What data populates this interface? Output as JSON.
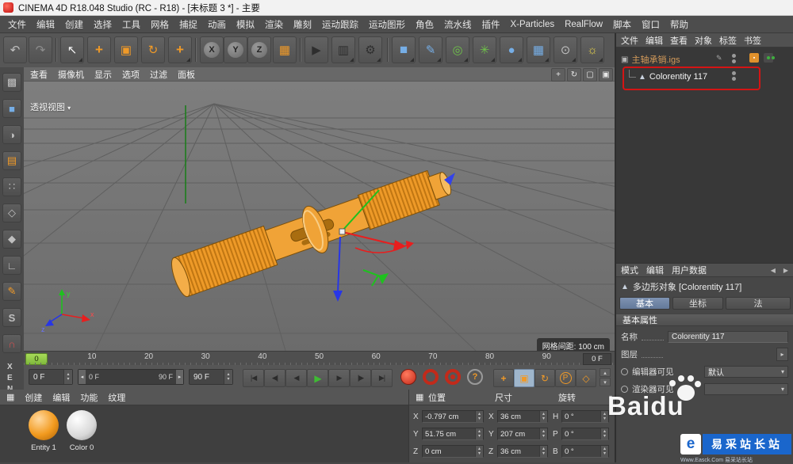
{
  "titlebar": {
    "title": "CINEMA 4D R18.048 Studio (RC - R18) - [未标题 3 *] - 主要"
  },
  "menubar": {
    "items": [
      "文件",
      "编辑",
      "创建",
      "选择",
      "工具",
      "网格",
      "捕捉",
      "动画",
      "模拟",
      "渲染",
      "雕刻",
      "运动跟踪",
      "运动图形",
      "角色",
      "流水线",
      "插件",
      "X-Particles",
      "RealFlow",
      "脚本",
      "窗口",
      "帮助"
    ]
  },
  "icons": {
    "undo": "↶",
    "redo": "↷",
    "select": "↖",
    "move": "+",
    "scale": "▣",
    "rotate": "↻",
    "last_tool": "+",
    "x": "X",
    "y": "Y",
    "z": "Z",
    "coords": "▦",
    "render_view": "▶",
    "render_region": "▥",
    "render_settings": "⚙",
    "cube": "■",
    "pen": "✎",
    "subdiv": "◎",
    "mograph": "✳",
    "metaball": "●",
    "array": "▦",
    "camera": "⊙",
    "light": "☼",
    "layout": "▩",
    "model": "■",
    "texture": "◑",
    "workplane": "▤",
    "points": "∷",
    "edges": "◇",
    "polygons": "◆",
    "axis": "∟",
    "pen2": "✎",
    "snap": "S",
    "magnet": "∩",
    "vp_pan": "+",
    "vp_rotate": "↻",
    "vp_scale": "▢",
    "vp_max": "▣",
    "grid_menu": "▦",
    "dropdown": "▾",
    "flyout": "▸",
    "spin_up": "▴",
    "spin_down": "▾",
    "jump_start": "|◀",
    "prev_key": "◀|",
    "prev_frame": "◀",
    "play": "▶",
    "next_frame": "▶",
    "next_key": "|▶",
    "jump_end": "▶|",
    "help": "?",
    "key_move": "+",
    "key_scale": "▣",
    "key_rotate": "↻",
    "key_param": "P",
    "key_pla": "◇",
    "pencil": "✎",
    "cube_small": "▣",
    "poly_obj": "▲",
    "back": "◀",
    "fwd": "▶"
  },
  "left_strip": {
    "letters": [
      "X",
      "E",
      "N"
    ]
  },
  "viewport": {
    "menu": [
      "查看",
      "摄像机",
      "显示",
      "选项",
      "过滤",
      "面板"
    ],
    "view_label": "透视视图",
    "grid_label": "网格间距: 100 cm"
  },
  "timeline": {
    "playhead": "0",
    "ticks": [
      "10",
      "20",
      "30",
      "40",
      "50",
      "60",
      "70",
      "80",
      "90"
    ],
    "ruler_field": "0 F"
  },
  "transport": {
    "current": "0 F",
    "range_start": "0 F",
    "range_end": "90 F",
    "end": "90 F"
  },
  "materials": {
    "menu": [
      "创建",
      "编辑",
      "功能",
      "纹理"
    ],
    "items": [
      {
        "name": "Entity 1"
      },
      {
        "name": "Color 0"
      }
    ]
  },
  "coordinates": {
    "groups": [
      {
        "title": "位置",
        "rows": [
          {
            "label": "X",
            "value": "-0.797 cm"
          },
          {
            "label": "Y",
            "value": "51.75 cm"
          },
          {
            "label": "Z",
            "value": "0 cm"
          }
        ]
      },
      {
        "title": "尺寸",
        "rows": [
          {
            "label": "X",
            "value": "36 cm"
          },
          {
            "label": "Y",
            "value": "207 cm"
          },
          {
            "label": "Z",
            "value": "36 cm"
          }
        ]
      },
      {
        "title": "旋转",
        "rows": [
          {
            "label": "H",
            "value": "0 °"
          },
          {
            "label": "P",
            "value": "0 °"
          },
          {
            "label": "B",
            "value": "0 °"
          }
        ]
      }
    ]
  },
  "object_manager": {
    "menu": [
      "文件",
      "编辑",
      "查看",
      "对象",
      "标签",
      "书签"
    ],
    "items": [
      {
        "name": "主轴承销.igs"
      },
      {
        "name": "Colorentity 117",
        "selected": true
      }
    ]
  },
  "attributes": {
    "menu": [
      "模式",
      "编辑",
      "用户数据"
    ],
    "title": "多边形对象 [Colorentity 117]",
    "tabs": [
      "基本",
      "坐标",
      "法"
    ],
    "section": "基本属性",
    "rows": [
      {
        "label": "名称",
        "value": "Colorentity 117"
      },
      {
        "label": "图层",
        "value": ""
      },
      {
        "label": "编辑器可见",
        "value": "默认"
      },
      {
        "label": "渲染器可见",
        "value": ""
      }
    ]
  },
  "watermarks": {
    "baidu": "Baidu",
    "easck_e": "e",
    "easck_name": "易采站长站",
    "easck_sub": "Www.Easck.Com 易采站长站"
  },
  "colors": {
    "accent_orange": "#f09a28",
    "annotation_red": "#d41414",
    "play_green": "#3fbb34",
    "active_tab_blue": "#6f84a8",
    "baidu_blue": "#1a66cc",
    "model_orange": "#ee9a28"
  }
}
